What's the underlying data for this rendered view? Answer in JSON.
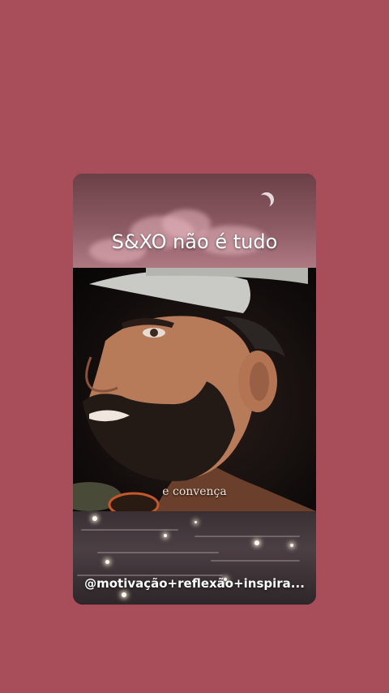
{
  "card": {
    "title": "S&XO não é tudo",
    "caption": "e convença",
    "handle": "@motivação+reflexão+inspira..."
  },
  "colors": {
    "background": "#a84d5a",
    "title_text": "#ffffff"
  },
  "icons": {
    "moon": "crescent-moon-icon"
  }
}
